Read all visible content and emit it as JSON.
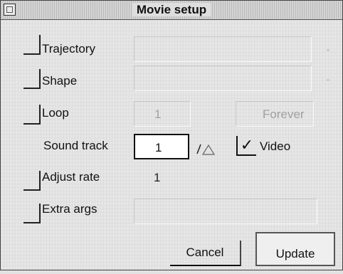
{
  "window": {
    "title": "Movie setup"
  },
  "options": {
    "trajectory": {
      "label": "Trajectory",
      "checked": false
    },
    "shape": {
      "label": "Shape",
      "checked": false
    },
    "loop": {
      "label": "Loop",
      "checked": false,
      "value": "1",
      "forever_label": "Forever"
    },
    "sound_track": {
      "label": "Sound track",
      "value": "1",
      "icon": "triangle-toggle-icon"
    },
    "video": {
      "label": "Video",
      "checked": true,
      "check_glyph": "✓"
    },
    "adjust_rate": {
      "label": "Adjust rate",
      "checked": false,
      "value": "1"
    },
    "extra_args": {
      "label": "Extra args",
      "checked": false
    }
  },
  "buttons": {
    "cancel": "Cancel",
    "update": "Update"
  }
}
